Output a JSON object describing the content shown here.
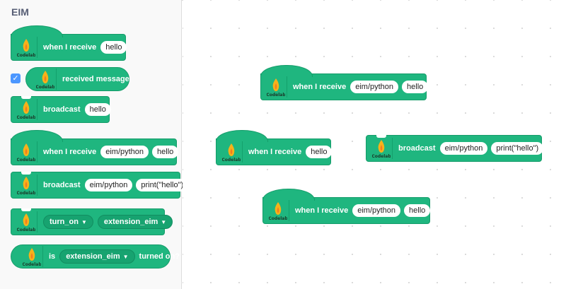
{
  "palette": {
    "category": "EIM",
    "blocks": {
      "when_receive_1": {
        "label": "when I receive",
        "arg": "hello"
      },
      "received_message": {
        "label": "received message",
        "checked": true
      },
      "broadcast_1": {
        "label": "broadcast",
        "arg": "hello"
      },
      "when_receive_2": {
        "label": "when I receive",
        "arg1": "eim/python",
        "arg2": "hello"
      },
      "broadcast_2": {
        "label": "broadcast",
        "arg1": "eim/python",
        "arg2": "print(\"hello\")"
      },
      "turn_on": {
        "opt1": "turn_on",
        "opt2": "extension_eim"
      },
      "is_on": {
        "prefix": "is",
        "opt": "extension_eim",
        "suffix": "turned on?"
      }
    }
  },
  "workspace": {
    "blocks": {
      "w1": {
        "label": "when I receive",
        "arg1": "eim/python",
        "arg2": "hello"
      },
      "w2": {
        "label": "when I receive",
        "arg": "hello"
      },
      "w3": {
        "label": "broadcast",
        "arg1": "eim/python",
        "arg2": "print(\"hello\")"
      },
      "w4": {
        "label": "when I receive",
        "arg1": "eim/python",
        "arg2": "hello"
      }
    }
  },
  "logo": {
    "text": "Codelab",
    "flame_color": "#f6b21a",
    "flame_inner": "#f47b20"
  },
  "colors": {
    "block": "#1fb67f",
    "border": "#159c6a",
    "checkbox": "#4c97ff"
  }
}
